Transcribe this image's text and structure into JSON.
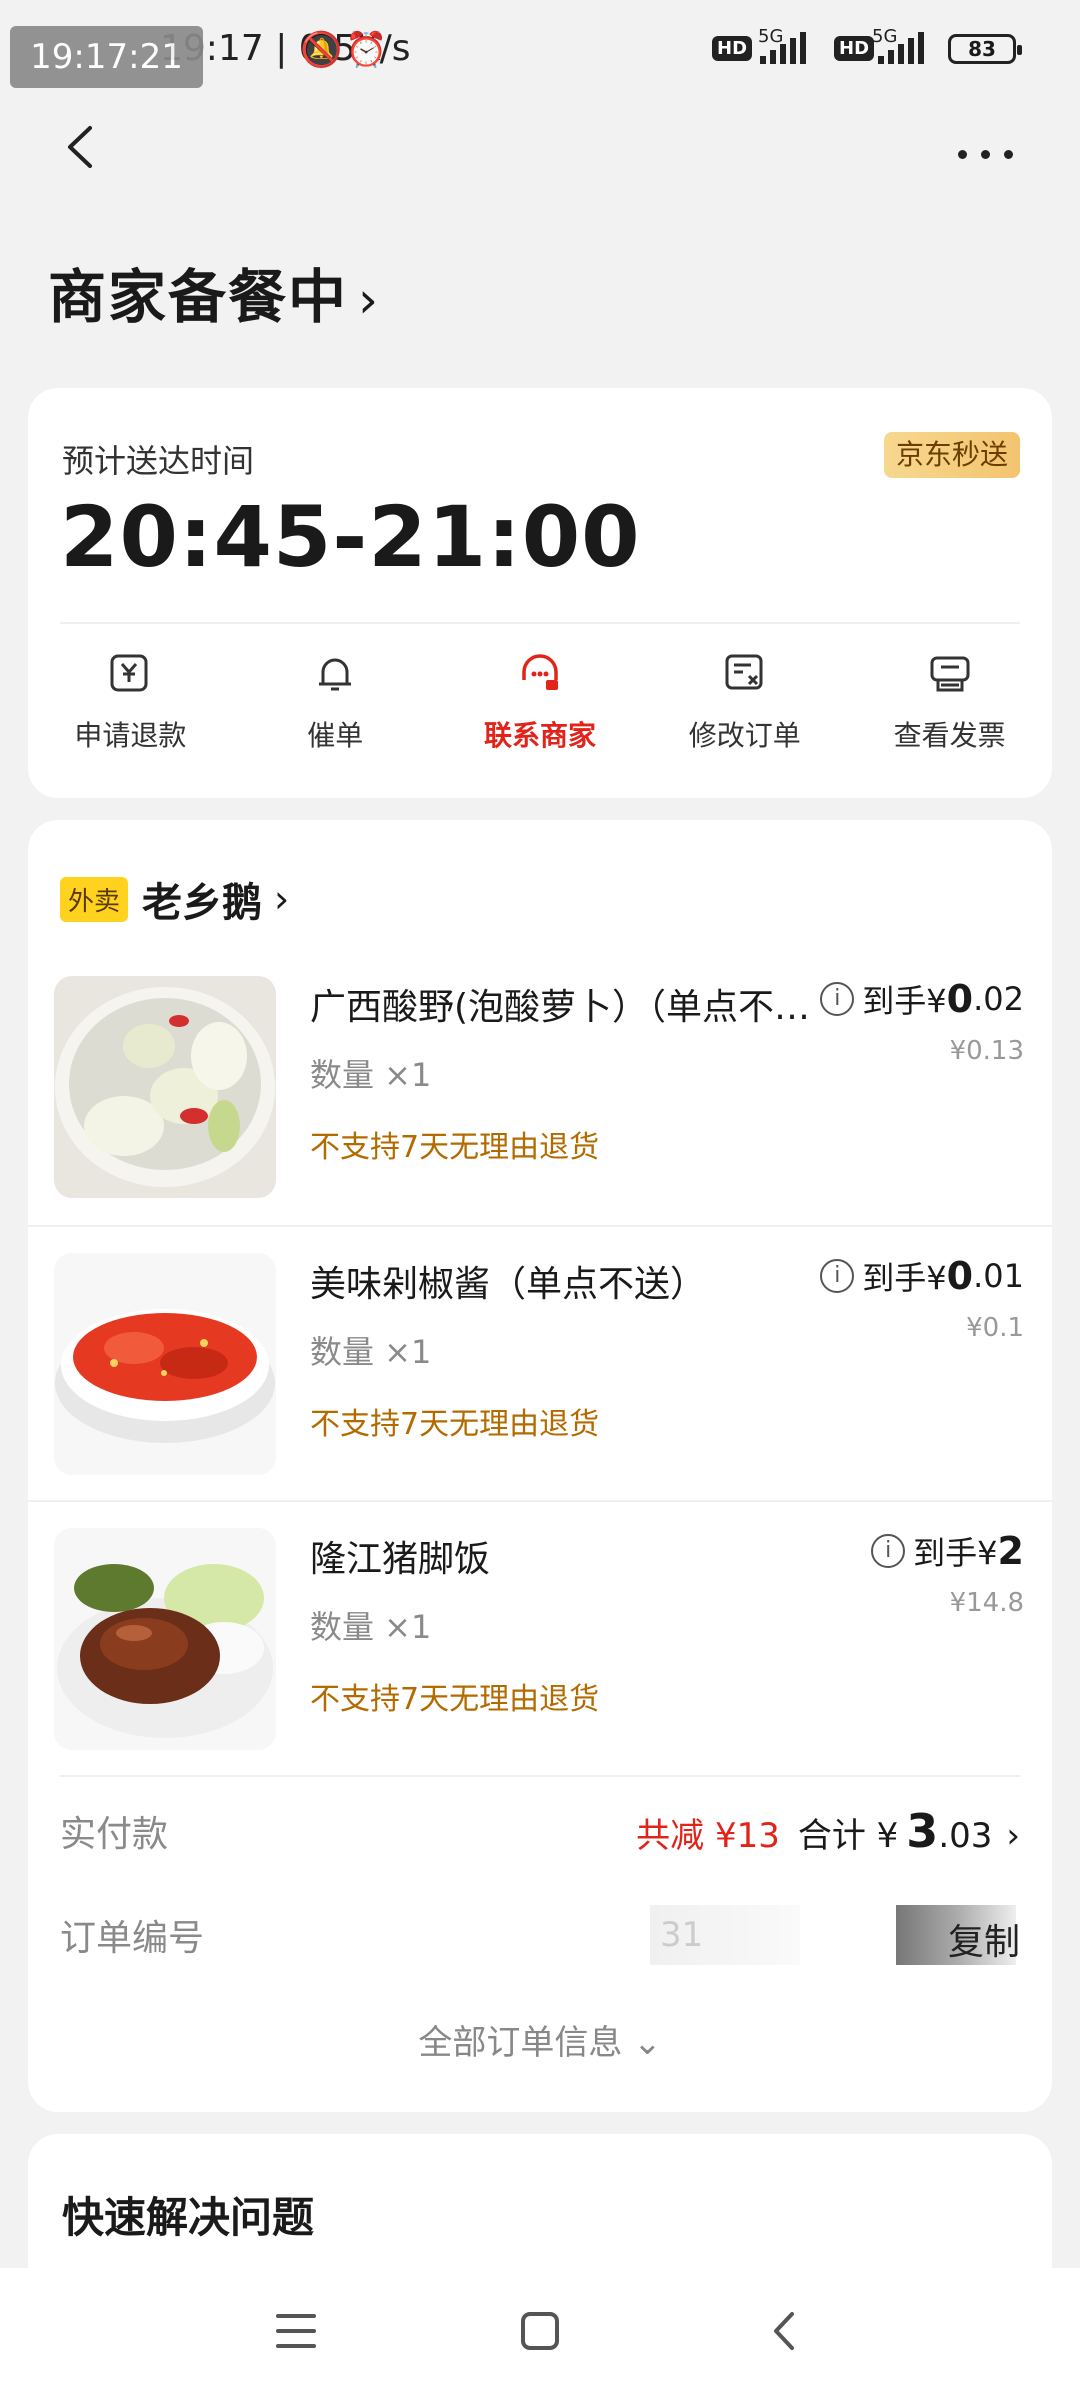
{
  "status_bar": {
    "time": "19:17:21",
    "speed": "0.5K/s",
    "hd": "HD",
    "net": "5G",
    "battery": "83"
  },
  "header": {
    "title": "商家备餐中",
    "chevron": "›"
  },
  "delivery": {
    "eta_label": "预计送达时间",
    "eta_time": "20:45-21:00",
    "badge": "京东秒送",
    "actions": [
      {
        "label": "申请退款",
        "icon": "refund-icon"
      },
      {
        "label": "催单",
        "icon": "bell-icon"
      },
      {
        "label": "联系商家",
        "icon": "merchant-service-icon",
        "active": true
      },
      {
        "label": "修改订单",
        "icon": "edit-order-icon"
      },
      {
        "label": "查看发票",
        "icon": "invoice-icon"
      }
    ]
  },
  "order": {
    "shop_tag": "外卖",
    "shop_name": "老乡鹅",
    "items": [
      {
        "title": "广西酸野(泡酸萝卜）（单点不送）",
        "qty": "数量 ×1",
        "policy": "不支持7天无理由退货",
        "price_prefix": "到手¥",
        "price_int": "0",
        "price_dec": ".02",
        "orig_price": "¥0.13"
      },
      {
        "title": "美味剁椒酱（单点不送）",
        "qty": "数量 ×1",
        "policy": "不支持7天无理由退货",
        "price_prefix": "到手¥",
        "price_int": "0",
        "price_dec": ".01",
        "orig_price": "¥0.1"
      },
      {
        "title": "隆江猪脚饭",
        "qty": "数量 ×1",
        "policy": "不支持7天无理由退货",
        "price_prefix": "到手¥",
        "price_int": "2",
        "price_dec": "",
        "orig_price": "¥14.8"
      }
    ],
    "payment_label": "实付款",
    "discount": "共减 ¥13",
    "total_label": "合计 ¥",
    "total_int": "3",
    "total_dec": ".03",
    "order_no_label": "订单编号",
    "order_no_partial": "31",
    "copy_label": "复制",
    "all_info": "全部订单信息 ⌄"
  },
  "quick": {
    "title": "快速解决问题"
  },
  "colors": {
    "accent_red": "#e2231a",
    "policy_orange": "#b36b00",
    "badge_gold": "#f3c46f"
  }
}
